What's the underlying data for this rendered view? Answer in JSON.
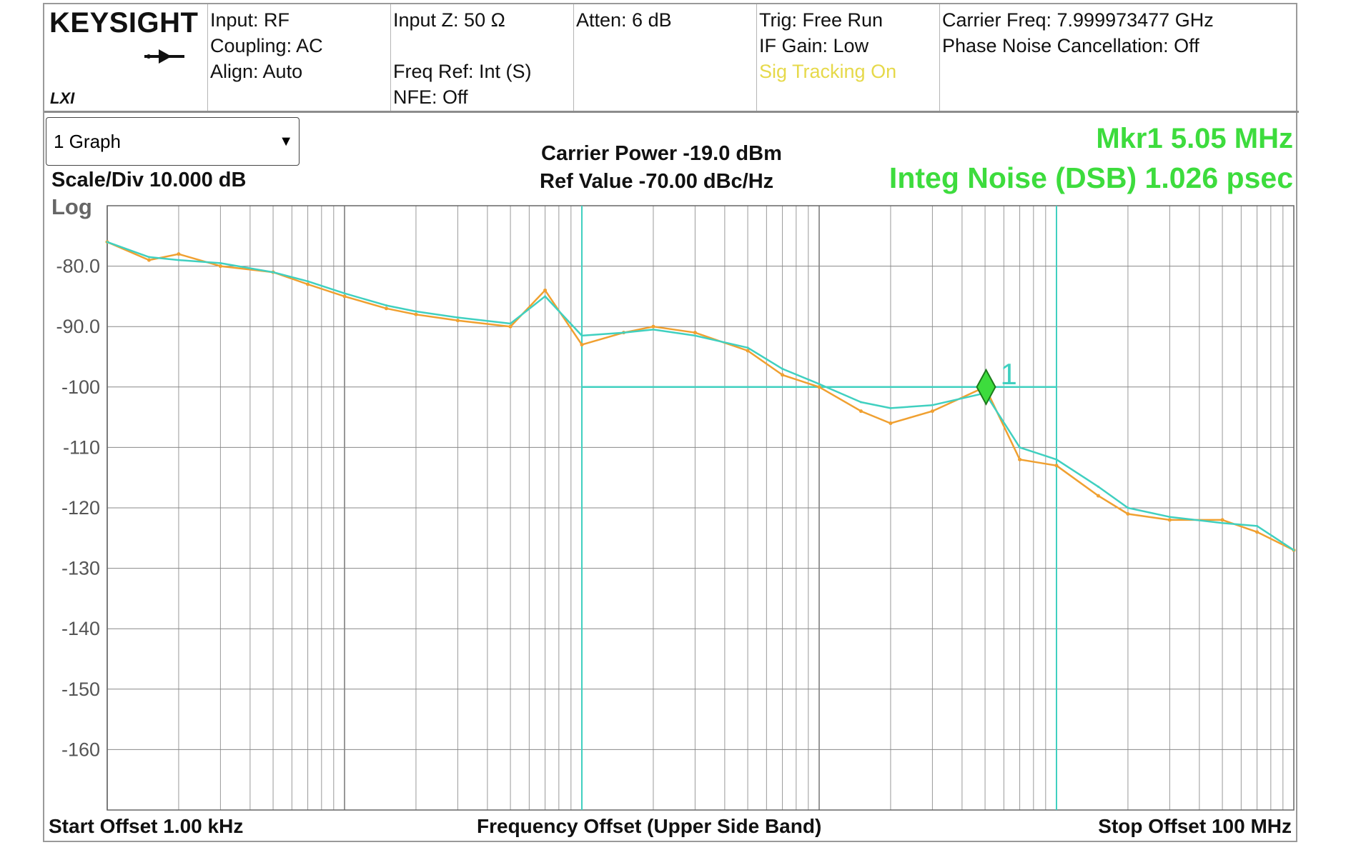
{
  "brand": "KEYSIGHT",
  "brand_sub": "LXI",
  "status": {
    "col1": [
      "Input: RF",
      "Coupling: AC",
      "Align: Auto"
    ],
    "col2": [
      "Input Z: 50 Ω",
      "",
      "Freq Ref: Int (S)",
      "NFE: Off"
    ],
    "col3": [
      "Atten: 6 dB"
    ],
    "col4": [
      "Trig: Free Run",
      "IF Gain: Low"
    ],
    "col4_highlight": "Sig Tracking  On",
    "col5": [
      "Carrier Freq: 7.999973477 GHz",
      "Phase Noise Cancellation: Off"
    ]
  },
  "graph_select": "1 Graph",
  "scale_div": "Scale/Div 10.000 dB",
  "log_label": "Log",
  "carrier_power": "Carrier Power -19.0 dBm",
  "ref_value": "Ref Value -70.00 dBc/Hz",
  "marker_freq": "Mkr1  5.05 MHz",
  "integ_noise": "Integ Noise (DSB)  1.026 psec",
  "start_offset": "Start Offset 1.00 kHz",
  "x_title": "Frequency Offset (Upper Side Band)",
  "stop_offset": "Stop Offset 100 MHz",
  "colors": {
    "raw_trace": "#f0a030",
    "smoothed_trace": "#40d0c0",
    "marker": "#3ddc3d",
    "grid": "#888888"
  },
  "chart_data": {
    "type": "line",
    "x_scale": "log",
    "xlabel": "Frequency Offset (Upper Side Band)",
    "xlim_hz": [
      1000,
      100000000
    ],
    "ylim": [
      -170,
      -70
    ],
    "yticks": [
      -80,
      -90,
      -100,
      -110,
      -120,
      -130,
      -140,
      -150,
      -160
    ],
    "ytick_labels": [
      "-80.0",
      "-90.0",
      "-100",
      "-110",
      "-120",
      "-130",
      "-140",
      "-150",
      "-160"
    ],
    "series": [
      {
        "style": "raw",
        "x": [
          1000,
          1500,
          2000,
          3000,
          5000,
          7000,
          10000,
          15000,
          20000,
          30000,
          50000,
          70000,
          100000,
          150000,
          200000,
          300000,
          500000,
          700000,
          1000000,
          1500000,
          2000000,
          3000000,
          5000000,
          7000000,
          10000000,
          15000000,
          20000000,
          30000000,
          50000000,
          70000000,
          100000000
        ],
        "y": [
          -76,
          -79,
          -78,
          -80,
          -81,
          -83,
          -85,
          -87,
          -88,
          -89,
          -90,
          -84,
          -93,
          -91,
          -90,
          -91,
          -94,
          -98,
          -100,
          -104,
          -106,
          -104,
          -100,
          -112,
          -113,
          -118,
          -121,
          -122,
          -122,
          -124,
          -127
        ]
      },
      {
        "style": "smoothed",
        "x": [
          1000,
          1500,
          2000,
          3000,
          5000,
          7000,
          10000,
          15000,
          20000,
          30000,
          50000,
          70000,
          100000,
          150000,
          200000,
          300000,
          500000,
          700000,
          1000000,
          1500000,
          2000000,
          3000000,
          5000000,
          7000000,
          10000000,
          15000000,
          20000000,
          30000000,
          50000000,
          70000000,
          100000000
        ],
        "y": [
          -76,
          -78.5,
          -79,
          -79.5,
          -81,
          -82.5,
          -84.5,
          -86.5,
          -87.5,
          -88.5,
          -89.5,
          -85,
          -91.5,
          -91,
          -90.5,
          -91.5,
          -93.5,
          -97,
          -99.5,
          -102.5,
          -103.5,
          -103,
          -101,
          -110,
          -112,
          -116.5,
          -120,
          -121.5,
          -122.5,
          -123,
          -127
        ]
      }
    ],
    "integration_range_hz": [
      100000,
      10000000
    ],
    "integration_level": -100,
    "marker": {
      "label": "1",
      "x_hz": 5050000,
      "y": -100
    }
  }
}
